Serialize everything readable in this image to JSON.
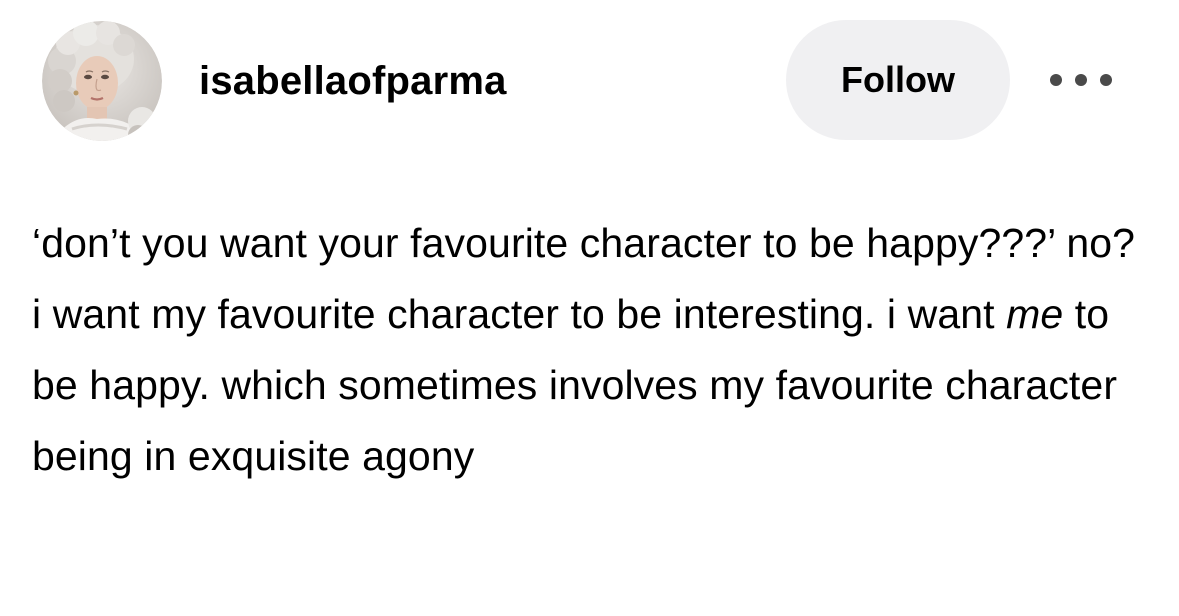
{
  "post": {
    "author": {
      "username": "isabellaofparma",
      "avatar_icon": "avatar-portrait"
    },
    "follow_label": "Follow",
    "more_icon": "more-options-icon",
    "body": {
      "part1": "‘don’t you want your favourite character to be happy???’ no? i want my favourite character to be interesting. i want ",
      "emphasis": "me",
      "part2": " to be happy. which sometimes involves my favourite character being in exquisite agony"
    }
  },
  "colors": {
    "follow_button_bg": "#f0f0f2",
    "text": "#000000",
    "icon": "#4a4a4a"
  }
}
